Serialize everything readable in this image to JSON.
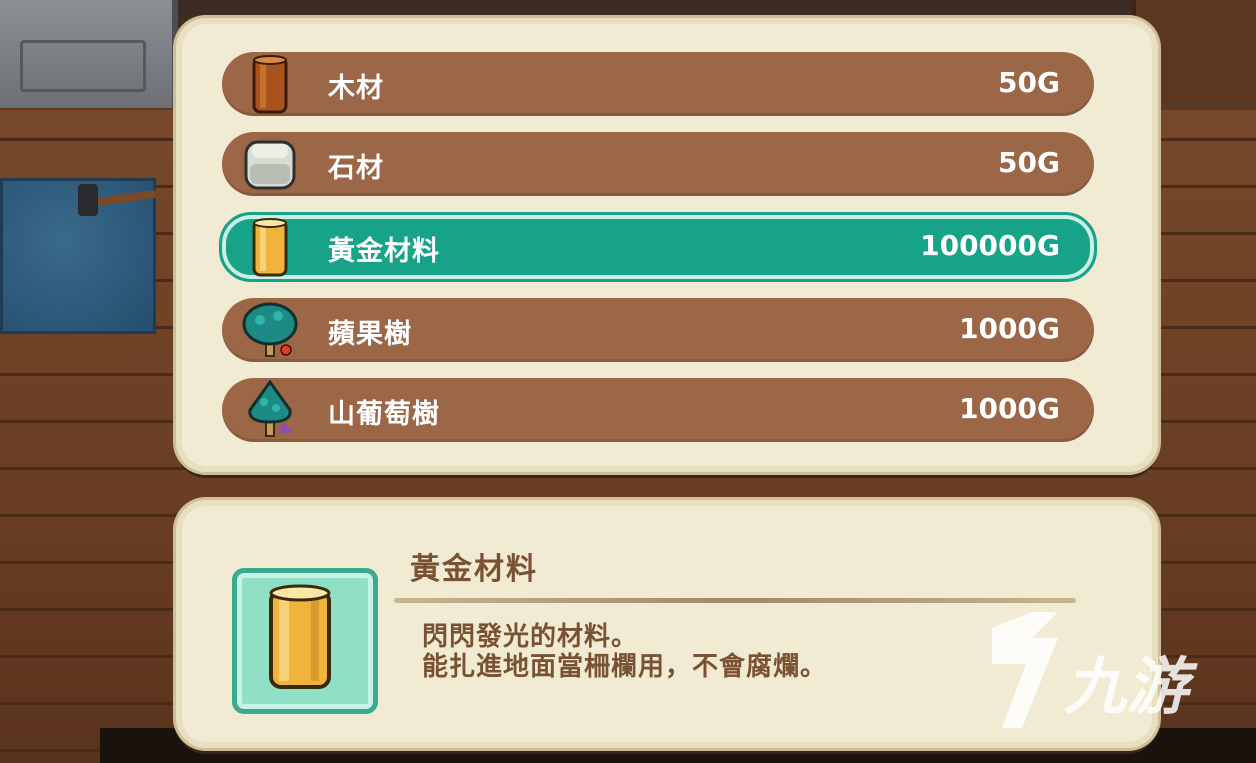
{
  "shop": {
    "items": [
      {
        "name": "木材",
        "price": "50G",
        "icon": "wood-log-icon",
        "selected": false
      },
      {
        "name": "石材",
        "price": "50G",
        "icon": "stone-block-icon",
        "selected": false
      },
      {
        "name": "黃金材料",
        "price": "100000G",
        "icon": "gold-log-icon",
        "selected": true
      },
      {
        "name": "蘋果樹",
        "price": "1000G",
        "icon": "apple-tree-icon",
        "selected": false
      },
      {
        "name": "山葡萄樹",
        "price": "1000G",
        "icon": "grape-tree-icon",
        "selected": false
      }
    ]
  },
  "detail": {
    "title": "黃金材料",
    "description_line1": "閃閃發光的材料。",
    "description_line2": "能扎進地面當柵欄用，不會腐爛。",
    "icon": "gold-log-icon"
  },
  "watermark": {
    "text": "九游",
    "icon": "jiuyou-logo-icon"
  },
  "colors": {
    "row": "#9c6746",
    "row_selected": "#17a387",
    "panel": "#f1ebd3",
    "text_brown": "#7a5233"
  }
}
